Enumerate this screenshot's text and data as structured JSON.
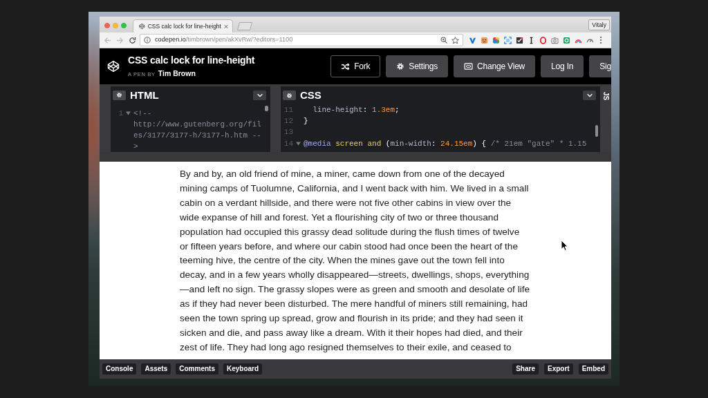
{
  "browser": {
    "tab_title": "CSS calc lock for line-height",
    "profile": "Vitaly",
    "url_host": "codepen.io",
    "url_path": "/timbrown/pen/akXvRw/?editors=1100"
  },
  "pen_header": {
    "title": "CSS calc lock for line-height",
    "byline_label": "A PEN BY",
    "author": "Tim Brown",
    "buttons": [
      {
        "label": "Fork",
        "kind": "fork"
      },
      {
        "label": "Settings",
        "kind": "settings"
      },
      {
        "label": "Change View",
        "kind": "view"
      },
      {
        "label": "Log In",
        "kind": "plain"
      },
      {
        "label": "Sig",
        "kind": "plain"
      }
    ]
  },
  "editors": [
    {
      "label": "HTML",
      "collapsed": false,
      "rows": [
        {
          "number": "1",
          "fold": true,
          "tokens": [
            {
              "kind": "comment",
              "text": "<!--"
            }
          ]
        },
        {
          "fold": false,
          "tokens": [
            {
              "kind": "comment",
              "text": "http://www.gutenberg.org/fil"
            }
          ]
        },
        {
          "fold": false,
          "tokens": [
            {
              "kind": "comment",
              "text": "es/3177/3177-h/3177-h.htm --"
            }
          ]
        },
        {
          "fold": false,
          "tokens": [
            {
              "kind": "comment",
              "text": ">"
            }
          ]
        }
      ]
    },
    {
      "label": "CSS",
      "collapsed": false,
      "rows": [
        {
          "number": "11",
          "fold": false,
          "tokens": [
            {
              "kind": "property",
              "text": "  line-height"
            },
            {
              "kind": "punctuation",
              "text": ": "
            },
            {
              "kind": "number",
              "text": "1.3em"
            },
            {
              "kind": "punctuation",
              "text": ";"
            }
          ]
        },
        {
          "number": "12",
          "fold": false,
          "tokens": [
            {
              "kind": "punctuation",
              "text": "}"
            }
          ]
        },
        {
          "number": "13",
          "fold": false
        },
        {
          "number": "14",
          "fold": true,
          "tokens": [
            {
              "kind": "atrule",
              "text": "@media "
            },
            {
              "kind": "keyword",
              "text": "screen and "
            },
            {
              "kind": "punctuation",
              "text": "("
            },
            {
              "kind": "property",
              "text": "min-width"
            },
            {
              "kind": "punctuation",
              "text": ": "
            },
            {
              "kind": "number",
              "text": "24.15em"
            },
            {
              "kind": "punctuation",
              "text": ") { "
            },
            {
              "kind": "comment",
              "text": "/* 21em \"gate\" * 1.15"
            }
          ]
        }
      ]
    },
    {
      "label": "JS",
      "collapsed": true
    }
  ],
  "preview": {
    "lines": [
      "By and by, an old friend of mine, a miner, came down from one of the decayed",
      "mining camps of Tuolumne, California, and I went back with him. We lived in a small",
      "cabin on a verdant hillside, and there were not five other cabins in view over the",
      "wide expanse of hill and forest. Yet a flourishing city of two or three thousand",
      "population had occupied this grassy dead solitude during the flush times of twelve",
      "or fifteen years before, and where our cabin stood had once been the heart of the",
      "teeming hive, the centre of the city. When the mines gave out the town fell into",
      "decay, and in a few years wholly disappeared—streets, dwellings, shops, everything",
      "—and left no sign. The grassy slopes were as green and smooth and desolate of life",
      "as if they had never been disturbed. The mere handful of miners still remaining, had",
      "seen the town spring up spread, grow and flourish in its pride; and they had seen it",
      "sicken and die, and pass away like a dream. With it their hopes had died, and their",
      "zest of life. They had long ago resigned themselves to their exile, and ceased to"
    ]
  },
  "footer": {
    "left_buttons": [
      "Console",
      "Assets",
      "Comments",
      "Keyboard"
    ],
    "right_buttons": [
      "Share",
      "Export",
      "Embed"
    ]
  }
}
